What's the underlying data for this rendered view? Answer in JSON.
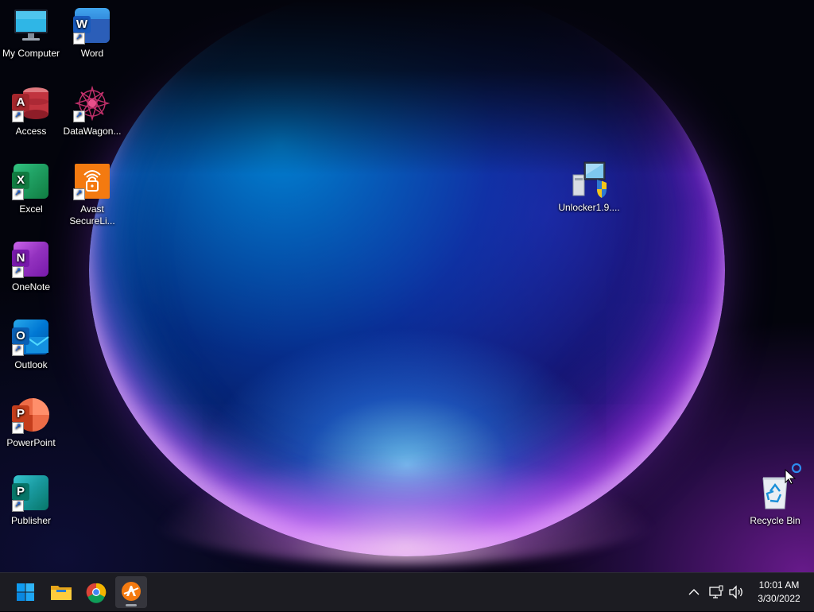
{
  "desktop": {
    "icons": [
      {
        "label": "My Computer",
        "icon": "monitor-icon"
      },
      {
        "label": "Word",
        "icon": "word-icon",
        "letter": "W"
      },
      {
        "label": "Access",
        "icon": "access-icon",
        "letter": "A"
      },
      {
        "label": "DataWagon...",
        "icon": "datawagon-icon"
      },
      {
        "label": "Excel",
        "icon": "excel-icon",
        "letter": "X"
      },
      {
        "label": "Avast SecureLi...",
        "icon": "avast-lock-icon"
      },
      {
        "label": "OneNote",
        "icon": "onenote-icon",
        "letter": "N"
      },
      {
        "label": "Outlook",
        "icon": "outlook-icon",
        "letter": "O"
      },
      {
        "label": "PowerPoint",
        "icon": "powerpoint-icon",
        "letter": "P"
      },
      {
        "label": "Publisher",
        "icon": "publisher-icon",
        "letter": "P"
      },
      {
        "label": "Unlocker1.9....",
        "icon": "installer-icon"
      },
      {
        "label": "Recycle Bin",
        "icon": "recycle-bin-icon"
      }
    ]
  },
  "taskbar": {
    "apps": [
      {
        "name": "Start",
        "icon": "windows-start-icon"
      },
      {
        "name": "File Explorer",
        "icon": "folder-icon"
      },
      {
        "name": "Google Chrome",
        "icon": "chrome-icon"
      },
      {
        "name": "Avast",
        "icon": "avast-icon",
        "active": true
      }
    ],
    "tray": {
      "time": "10:01 AM",
      "date": "3/30/2022"
    }
  },
  "colors": {
    "word": "#2b5eb8",
    "access": "#b32b38",
    "excel": "#1d7a45",
    "onenote": "#8a2fbf",
    "outlook": "#1266c4",
    "powerpoint": "#d24626",
    "publisher": "#077568",
    "avast": "#f47a10",
    "taskbar": "#1c1c22"
  }
}
